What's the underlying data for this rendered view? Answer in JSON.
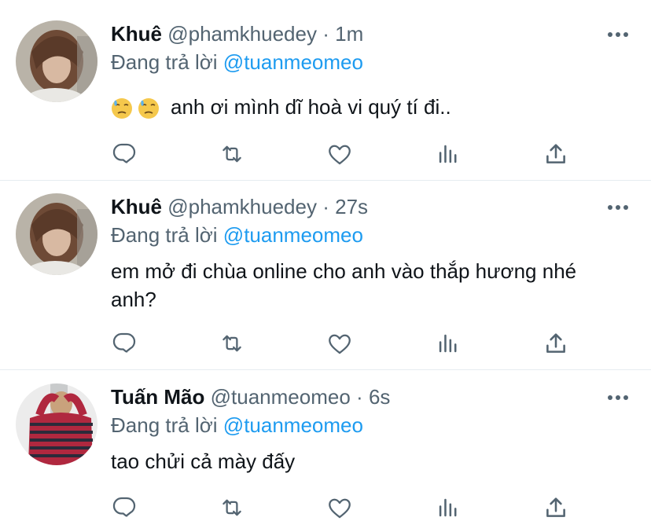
{
  "tweets": [
    {
      "name": "Khuê",
      "handle": "@phamkhuedey",
      "sep": "·",
      "time": "1m",
      "reply_prefix": "Đang trả lời",
      "reply_to": "@tuanmeomeo",
      "text": "anh ơi mình dĩ hoà vi quý tí đi..",
      "emojis": [
        "downcast-sweat-face-icon",
        "downcast-sweat-face-icon"
      ]
    },
    {
      "name": "Khuê",
      "handle": "@phamkhuedey",
      "sep": "·",
      "time": "27s",
      "reply_prefix": "Đang trả lời",
      "reply_to": "@tuanmeomeo",
      "text": "em mở đi chùa online cho anh vào thắp hương nhé anh?"
    },
    {
      "name": "Tuấn Mão",
      "handle": "@tuanmeomeo",
      "sep": "·",
      "time": "6s",
      "reply_prefix": "Đang trả lời",
      "reply_to": "@tuanmeomeo",
      "text": "tao chửi cả mày đấy"
    }
  ],
  "actions": [
    "reply-icon",
    "retweet-icon",
    "like-icon",
    "analytics-icon",
    "share-icon"
  ],
  "colors": {
    "link": "#1d9bf0",
    "muted": "#536471",
    "text": "#0f1419",
    "divider": "#e6ecf0"
  }
}
